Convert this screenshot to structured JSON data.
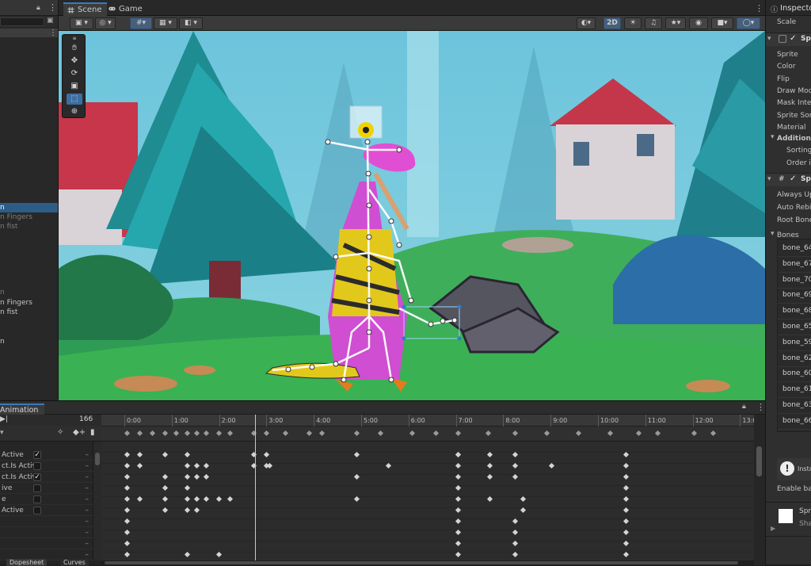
{
  "hierarchy": {
    "rows": [
      {
        "label": "n",
        "state": "selected"
      },
      {
        "label": "n Fingers",
        "state": "dim"
      },
      {
        "label": "n fist",
        "state": "dim"
      },
      {
        "label": "n",
        "state": "dim"
      },
      {
        "label": "n Fingers",
        "state": "normal"
      },
      {
        "label": "n fist",
        "state": "normal"
      },
      {
        "label": "n",
        "state": "normal"
      }
    ]
  },
  "scene": {
    "tabs": [
      {
        "label": "Scene",
        "icon": "hash-icon",
        "active": true
      },
      {
        "label": "Game",
        "icon": "gamepad-icon",
        "active": false
      }
    ],
    "toolbar_2d": "2D"
  },
  "animation": {
    "tab_label": "Animation",
    "frame": "166",
    "ruler": [
      "0:00",
      "1:00",
      "2:00",
      "3:00",
      "4:00",
      "5:00",
      "6:00",
      "7:00",
      "8:00",
      "9:00",
      "10:00",
      "11:00",
      "12:00",
      "13:00"
    ],
    "properties": [
      {
        "label": " Active",
        "checked": true
      },
      {
        "label": "ct.Is Activ",
        "checked": false
      },
      {
        "label": "ct.Is Activ",
        "checked": true
      },
      {
        "label": "ive",
        "checked": false
      },
      {
        "label": "e",
        "checked": false
      },
      {
        "label": " Active",
        "checked": false
      },
      {
        "label": "",
        "checked": null
      },
      {
        "label": "",
        "checked": null
      },
      {
        "label": "",
        "checked": null
      },
      {
        "label": "",
        "checked": null
      }
    ],
    "bottom_tabs": [
      "Dopesheet",
      "Curves"
    ]
  },
  "inspector": {
    "title": "Inspector",
    "scale_label": "Scale",
    "sprite_component": "Spr",
    "sprite_fields": [
      "Sprite",
      "Color",
      "Flip",
      "Draw Mod",
      "Mask Inte",
      "Sprite Sor",
      "Material"
    ],
    "additional": "Additiona",
    "additional_fields": [
      "Sorting",
      "Order in"
    ],
    "skin_component": "Spr",
    "skin_fields": [
      "Always Up",
      "Auto Rebi",
      "Root Bone"
    ],
    "bones_label": "Bones",
    "bones": [
      "bone_64",
      "bone_67",
      "bone_70",
      "bone_69",
      "bone_68",
      "bone_65",
      "bone_59",
      "bone_62",
      "bone_60",
      "bone_61",
      "bone_63",
      "bone_66"
    ],
    "info_text": "Insta",
    "enable_text": "Enable ba",
    "sprite_preview": "Spr",
    "shape_text": "Sha"
  },
  "colors": {
    "accent": "#3a79bb",
    "selected_row": "#2c5d87",
    "panel": "#282828"
  }
}
